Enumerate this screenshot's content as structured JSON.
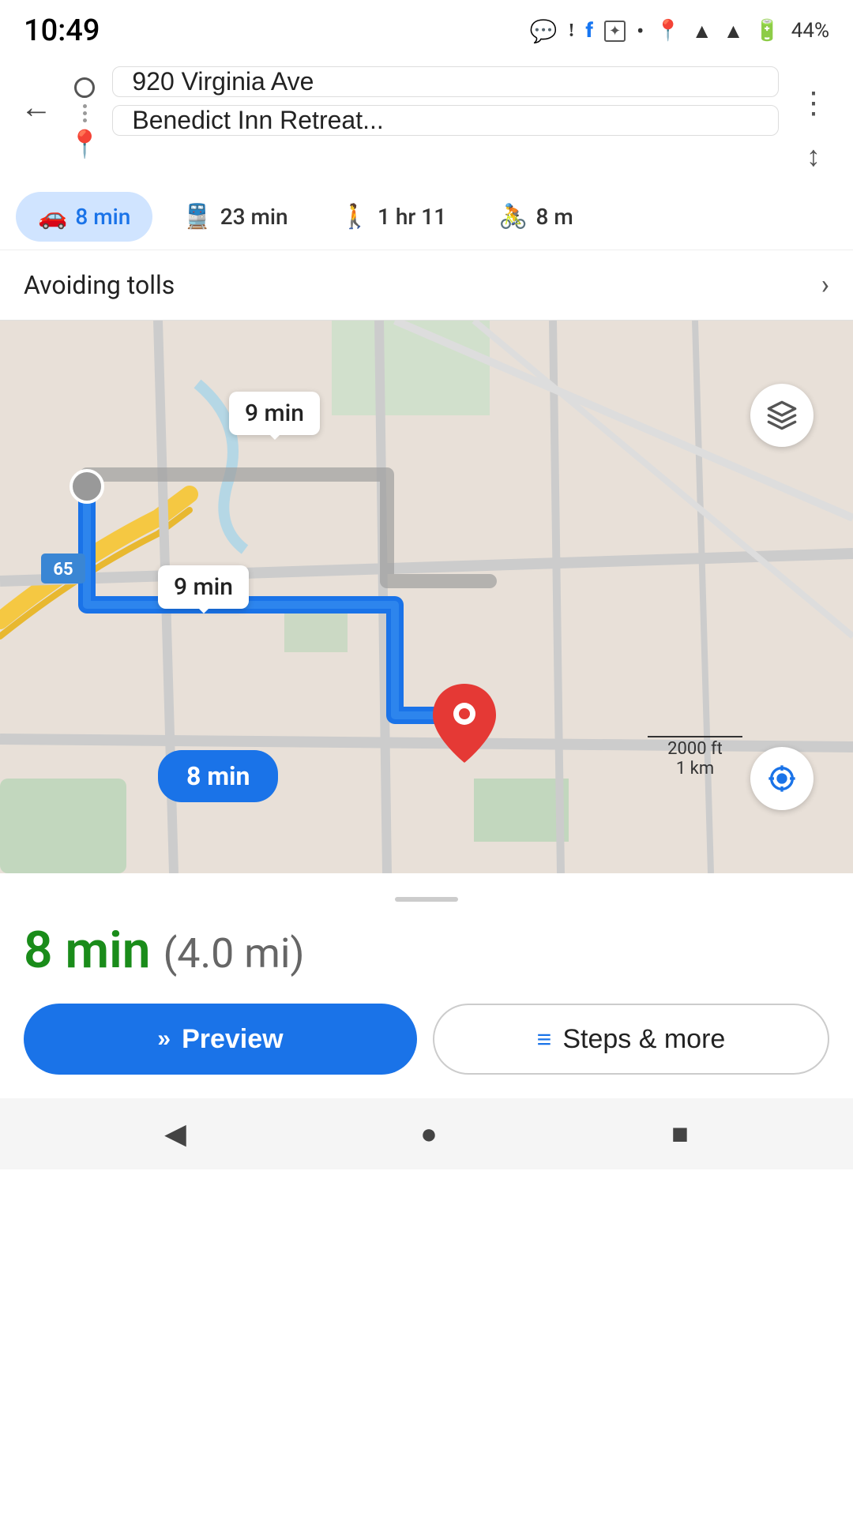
{
  "statusBar": {
    "time": "10:49",
    "battery": "44%",
    "icons": [
      "chat-icon",
      "shazam-icon",
      "facebook-icon",
      "star-icon",
      "dot-icon"
    ]
  },
  "nav": {
    "backLabel": "←",
    "origin": "920 Virginia Ave",
    "destination": "Benedict Inn Retreat...",
    "moreLabel": "⋮",
    "swapLabel": "⇅"
  },
  "transportTabs": [
    {
      "id": "drive",
      "label": "8 min",
      "icon": "🚗",
      "active": true
    },
    {
      "id": "transit",
      "label": "23 min",
      "icon": "🚆",
      "active": false
    },
    {
      "id": "walk",
      "label": "1 hr 11",
      "icon": "🚶",
      "active": false
    },
    {
      "id": "bike",
      "label": "8 m",
      "icon": "🚴",
      "active": false
    }
  ],
  "avoidingTolls": {
    "label": "Avoiding tolls",
    "chevron": "›"
  },
  "map": {
    "label1": "9 min",
    "label2": "9 min",
    "labelBest": "8 min",
    "scaleImperial": "2000 ft",
    "scaleMetric": "1 km",
    "roadShield": "65",
    "layersIcon": "layers-icon",
    "locationIcon": "my-location-icon"
  },
  "bottomPanel": {
    "dragHandle": true,
    "routeTime": "8 min",
    "routeDistance": "(4.0 mi)",
    "previewLabel": "Preview",
    "previewIcon": "»",
    "stepsLabel": "Steps & more",
    "stepsIcon": "≡"
  },
  "systemNav": {
    "backIcon": "◀",
    "homeIcon": "●",
    "recentsIcon": "■"
  }
}
